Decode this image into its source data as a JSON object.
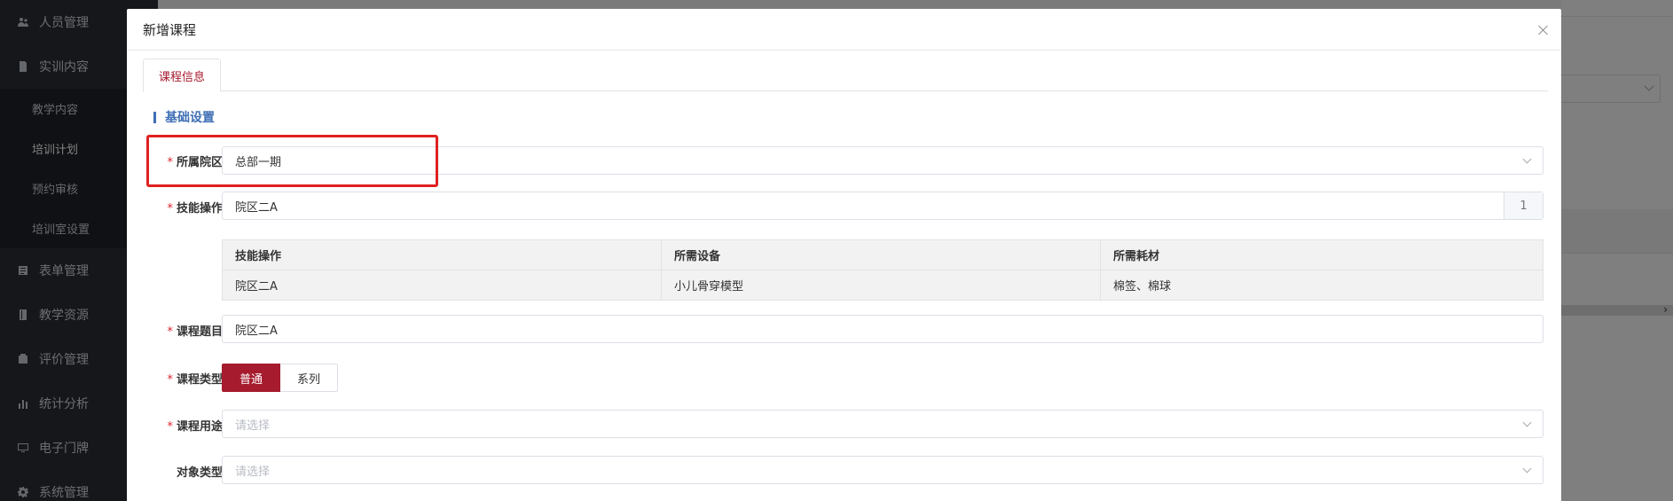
{
  "sidebar": {
    "items": [
      {
        "label": "人员管理",
        "icon": "users-icon"
      },
      {
        "label": "实训内容",
        "icon": "document-icon"
      }
    ],
    "sub_items": [
      {
        "label": "教学内容"
      },
      {
        "label": "培训计划"
      },
      {
        "label": "预约审核"
      },
      {
        "label": "培训室设置"
      }
    ],
    "items_after": [
      {
        "label": "表单管理",
        "icon": "form-icon"
      },
      {
        "label": "教学资源",
        "icon": "book-icon"
      },
      {
        "label": "评价管理",
        "icon": "evaluation-icon"
      },
      {
        "label": "统计分析",
        "icon": "bar-chart-icon"
      },
      {
        "label": "电子门牌",
        "icon": "monitor-icon"
      },
      {
        "label": "系统管理",
        "icon": "gear-icon"
      }
    ]
  },
  "dialog": {
    "title": "新增课程",
    "tab": "课程信息",
    "section": "基础设置",
    "fields": {
      "campus": {
        "label": "所属院区",
        "value": "总部一期"
      },
      "skill": {
        "label": "技能操作",
        "value": "院区二A",
        "count": "1"
      },
      "course_title": {
        "label": "课程题目",
        "value": "院区二A"
      },
      "course_type": {
        "label": "课程类型",
        "options": [
          "普通",
          "系列"
        ],
        "selected": "普通"
      },
      "course_use": {
        "label": "课程用途",
        "placeholder": "请选择"
      },
      "target_type": {
        "label": "对象类型",
        "placeholder": "请选择"
      }
    },
    "table": {
      "headers": [
        "技能操作",
        "所需设备",
        "所需耗材"
      ],
      "rows": [
        [
          "院区二A",
          "小儿骨穿模型",
          "棉签、棉球"
        ]
      ]
    }
  },
  "colors": {
    "accent": "#a61b2e",
    "section": "#3f6fb5",
    "highlight": "#e02020",
    "required": "#e0242e"
  }
}
